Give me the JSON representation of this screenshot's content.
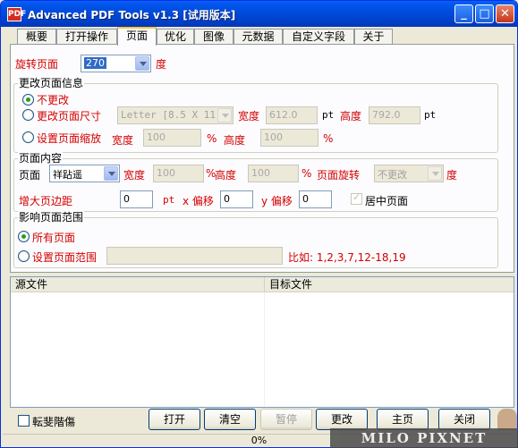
{
  "window": {
    "title": "Advanced PDF Tools  v1.3 [试用版本]",
    "icon_label": "PDF",
    "controls": {
      "minimize": "_",
      "maximize": "□",
      "close": "✕"
    }
  },
  "tabs": [
    {
      "label": "概要",
      "active": false
    },
    {
      "label": "打开操作",
      "active": false
    },
    {
      "label": "页面",
      "active": true
    },
    {
      "label": "优化",
      "active": false
    },
    {
      "label": "图像",
      "active": false
    },
    {
      "label": "元数据",
      "active": false
    },
    {
      "label": "自定义字段",
      "active": false
    },
    {
      "label": "关于",
      "active": false
    }
  ],
  "rotate": {
    "label": "旋转页面",
    "value": "270",
    "unit": "度"
  },
  "page_info": {
    "title": "更改页面信息",
    "no_change": "不更改",
    "change_size": "更改页面尺寸",
    "size_select": "Letter [8.5 X 11 in]",
    "width_label": "宽度",
    "width_value": "612.0",
    "pt1": "pt",
    "height_label": "高度",
    "height_value": "792.0",
    "pt2": "pt",
    "set_scale": "设置页面缩放",
    "scale_w_label": "宽度",
    "scale_w_value": "100",
    "pct1": "%",
    "scale_h_label": "高度",
    "scale_h_value": "100",
    "pct2": "%"
  },
  "content": {
    "title": "页面内容",
    "page_label": "页面",
    "page_select": "祥跕遥",
    "w_label": "宽度",
    "w_value": "100",
    "pct1": "%",
    "h_label": "高度",
    "h_value": "100",
    "pct2": "%",
    "rot_label": "页面旋转",
    "rot_select": "不更改",
    "rot_unit": "度",
    "margin_label": "增大页边距",
    "margin_value": "0",
    "pt": "pt",
    "x_label": "x 偏移",
    "x_value": "0",
    "y_label": "y 偏移",
    "y_value": "0",
    "center_label": "居中页面"
  },
  "range": {
    "title": "影响页面范围",
    "all_pages": "所有页面",
    "set_range": "设置页面范围",
    "range_value": "",
    "example": "比如: 1,2,3,7,12-18,19"
  },
  "list": {
    "col_source": "源文件",
    "col_target": "目标文件"
  },
  "bottom": {
    "checkbox_label": "転斐階傷",
    "open": "打开",
    "clear": "清空",
    "pause": "暂停",
    "change": "更改",
    "home": "主页",
    "close": "关闭"
  },
  "status": {
    "progress": "0%"
  },
  "watermark": "MILO PIXNET"
}
